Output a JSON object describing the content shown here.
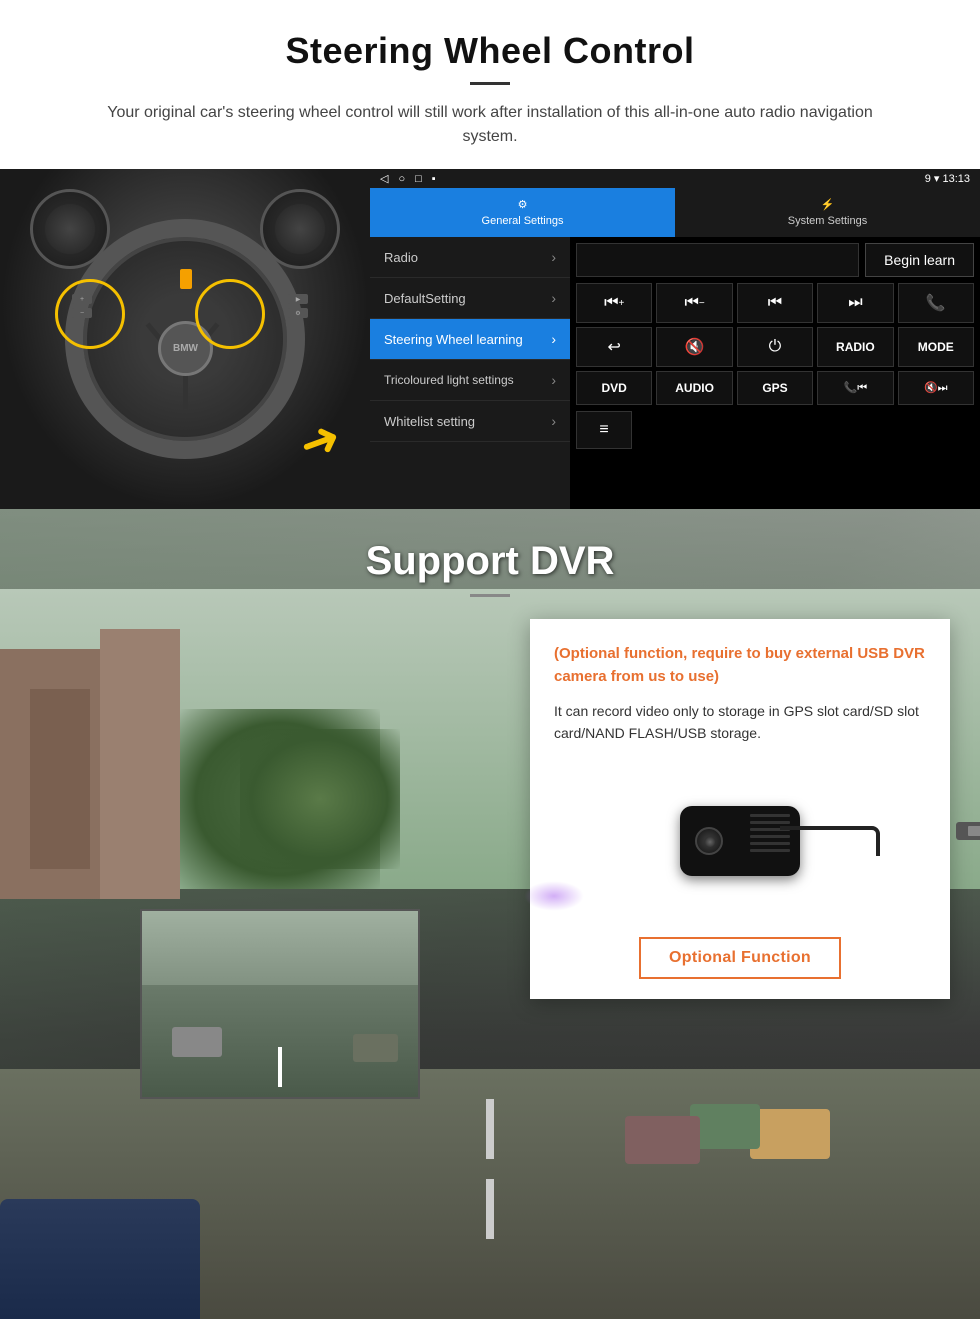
{
  "steering": {
    "title": "Steering Wheel Control",
    "subtitle": "Your original car's steering wheel control will still work after installation of this all-in-one auto radio navigation system.",
    "statusBar": {
      "icons": [
        "◁",
        "○",
        "□",
        "▪"
      ],
      "signal": "9 ▾ 13:13"
    },
    "tabs": [
      {
        "id": "general",
        "label": "General Settings",
        "icon": "⚙",
        "active": true
      },
      {
        "id": "system",
        "label": "System Settings",
        "icon": "⚡",
        "active": false
      }
    ],
    "menu": [
      {
        "id": "radio",
        "label": "Radio",
        "active": false
      },
      {
        "id": "default",
        "label": "DefaultSetting",
        "active": false
      },
      {
        "id": "steering",
        "label": "Steering Wheel learning",
        "active": true
      },
      {
        "id": "tricoloured",
        "label": "Tricoloured light settings",
        "active": false
      },
      {
        "id": "whitelist",
        "label": "Whitelist setting",
        "active": false
      }
    ],
    "beginLearnBtn": "Begin learn",
    "controlButtons": [
      "⏮+",
      "⏮−",
      "⏮⏮",
      "⏭⏭",
      "📞",
      "↩",
      "🔇",
      "⏻",
      "RADIO",
      "MODE",
      "DVD",
      "AUDIO",
      "GPS",
      "📞⏮",
      "🔇⏭"
    ],
    "extraBtn": "≡"
  },
  "dvr": {
    "title": "Support DVR",
    "optionalText": "(Optional function, require to buy external USB DVR camera from us to use)",
    "descText": "It can record video only to storage in GPS slot card/SD slot card/NAND FLASH/USB storage.",
    "optionalFuncBtn": "Optional Function"
  }
}
